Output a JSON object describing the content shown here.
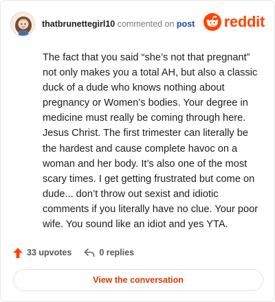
{
  "header": {
    "username": "thatbrunettegirl10",
    "commented_on": "commented on",
    "post_label": "post",
    "brand": "reddit"
  },
  "comment": {
    "body": "The fact that you said “she’s not that pregnant” not only makes you a total AH, but also a classic duck of a dude who knows nothing about pregnancy or Women’s bodies. Your degree in medicine must really be coming through here. Jesus Christ. The first trimester can literally be the hardest and cause complete havoc on a woman and her body. It’s also one of the most scary times. I get getting frustrated but come on dude... don’t throw out sexist and idiotic comments if you literally have no clue. Your poor wife. You sound like an idiot and yes YTA."
  },
  "footer": {
    "upvotes": "33 upvotes",
    "replies": "0 replies"
  },
  "cta": {
    "label": "View the conversation"
  },
  "colors": {
    "brand": "#ff4500",
    "link": "#1a4a9c",
    "cta_text": "#d93a00"
  },
  "icons": {
    "avatar": "user-avatar",
    "logo": "reddit-snoo-icon",
    "upvote": "upvote-arrow-icon",
    "reply": "reply-arrow-icon"
  }
}
